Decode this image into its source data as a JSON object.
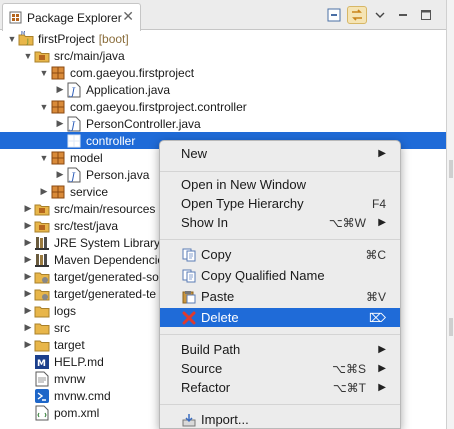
{
  "view": {
    "tab_title": "Package Explorer",
    "close_glyph": "✕"
  },
  "tree": [
    {
      "label": "firstProject",
      "suffix": "[boot]",
      "icon": "project-icon",
      "state": "expanded"
    },
    {
      "label": "src/main/java",
      "icon": "source-folder-icon",
      "state": "expanded"
    },
    {
      "label": "com.gaeyou.firstproject",
      "icon": "package-icon",
      "state": "expanded"
    },
    {
      "label": "Application.java",
      "icon": "java-file-icon",
      "state": "collapsed"
    },
    {
      "label": "com.gaeyou.firstproject.controller",
      "icon": "package-icon",
      "state": "expanded"
    },
    {
      "label": "PersonController.java",
      "icon": "java-file-icon",
      "state": "collapsed"
    },
    {
      "label": "controller",
      "icon": "empty-package-icon",
      "state": "none",
      "selected": true
    },
    {
      "label": "model",
      "icon": "package-icon",
      "state": "expanded"
    },
    {
      "label": "Person.java",
      "icon": "java-file-icon",
      "state": "collapsed"
    },
    {
      "label": "service",
      "icon": "package-icon",
      "state": "collapsed"
    },
    {
      "label": "src/main/resources",
      "icon": "source-folder-icon",
      "state": "collapsed"
    },
    {
      "label": "src/test/java",
      "icon": "source-folder-icon",
      "state": "collapsed"
    },
    {
      "label": "JRE System Library",
      "icon": "library-icon",
      "state": "collapsed"
    },
    {
      "label": "Maven Dependencies",
      "icon": "library-icon",
      "state": "collapsed"
    },
    {
      "label": "target/generated-so",
      "icon": "generated-folder-icon",
      "state": "collapsed"
    },
    {
      "label": "target/generated-te",
      "icon": "generated-folder-icon",
      "state": "collapsed"
    },
    {
      "label": "logs",
      "icon": "folder-icon",
      "state": "collapsed"
    },
    {
      "label": "src",
      "icon": "folder-icon",
      "state": "collapsed"
    },
    {
      "label": "target",
      "icon": "folder-icon",
      "state": "collapsed"
    },
    {
      "label": "HELP.md",
      "icon": "markdown-file-icon",
      "state": "none"
    },
    {
      "label": "mvnw",
      "icon": "text-file-icon",
      "state": "none"
    },
    {
      "label": "mvnw.cmd",
      "icon": "cmd-file-icon",
      "state": "none"
    },
    {
      "label": "pom.xml",
      "icon": "xml-file-icon",
      "state": "none"
    }
  ],
  "menu": {
    "new": {
      "label": "New",
      "arrow": "▶"
    },
    "open_new_window": {
      "label": "Open in New Window"
    },
    "open_type_hierarchy": {
      "label": "Open Type Hierarchy",
      "shortcut": "F4"
    },
    "show_in": {
      "label": "Show In",
      "shortcut": "⌥⌘W",
      "arrow": "▶"
    },
    "copy": {
      "label": "Copy",
      "shortcut": "⌘C"
    },
    "copy_qualified": {
      "label": "Copy Qualified Name"
    },
    "paste": {
      "label": "Paste",
      "shortcut": "⌘V"
    },
    "delete": {
      "label": "Delete",
      "shortcut": "⌦"
    },
    "build_path": {
      "label": "Build Path",
      "arrow": "▶"
    },
    "source": {
      "label": "Source",
      "shortcut": "⌥⌘S",
      "arrow": "▶"
    },
    "refactor": {
      "label": "Refactor",
      "shortcut": "⌥⌘T",
      "arrow": "▶"
    },
    "import": {
      "label": "Import..."
    }
  },
  "colors": {
    "selection": "#1f6bd8",
    "package": "#b5651d",
    "folder": "#e8b64a"
  }
}
